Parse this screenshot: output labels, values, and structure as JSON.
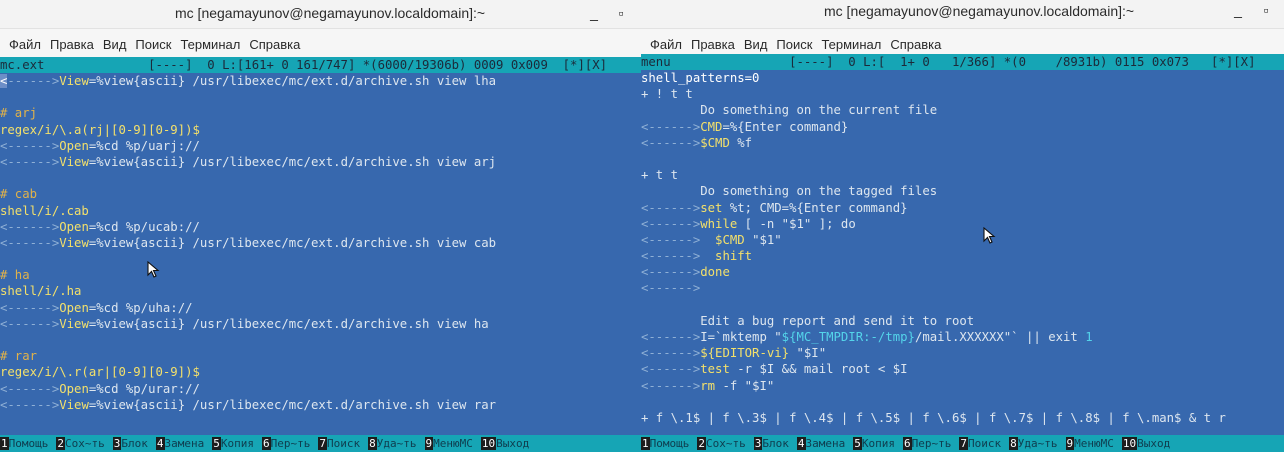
{
  "left": {
    "title": "mc [negamayunov@negamayunov.localdomain]:~",
    "btn_min": "_",
    "btn_max": "▫",
    "menu": [
      "Файл",
      "Правка",
      "Вид",
      "Поиск",
      "Терминал",
      "Справка"
    ],
    "status": "mc.ext              [----]  0 L:[161+ 0 161/747] *(6000/19306b) 0009 0x009  [*][X]",
    "lines": [
      [
        [
          "<",
          "sel"
        ],
        [
          "------>",
          "dim"
        ],
        [
          "View",
          "key"
        ],
        [
          "=%view{ascii} /usr/libexec/mc/ext.d/archive.sh view lha",
          "txt"
        ]
      ],
      [
        [
          "",
          "txt"
        ]
      ],
      [
        [
          "# arj",
          "cmt"
        ]
      ],
      [
        [
          "regex/i/\\.a(rj|[0-9][0-9])$",
          "key"
        ]
      ],
      [
        [
          "<------>",
          "dim"
        ],
        [
          "Open",
          "key"
        ],
        [
          "=%cd %p/uarj://",
          "txt"
        ]
      ],
      [
        [
          "<------>",
          "dim"
        ],
        [
          "View",
          "key"
        ],
        [
          "=%view{ascii} /usr/libexec/mc/ext.d/archive.sh view arj",
          "txt"
        ]
      ],
      [
        [
          "",
          "txt"
        ]
      ],
      [
        [
          "# cab",
          "cmt"
        ]
      ],
      [
        [
          "shell/i/.cab",
          "key"
        ]
      ],
      [
        [
          "<------>",
          "dim"
        ],
        [
          "Open",
          "key"
        ],
        [
          "=%cd %p/ucab://",
          "txt"
        ]
      ],
      [
        [
          "<------>",
          "dim"
        ],
        [
          "View",
          "key"
        ],
        [
          "=%view{ascii} /usr/libexec/mc/ext.d/archive.sh view cab",
          "txt"
        ]
      ],
      [
        [
          "",
          "txt"
        ]
      ],
      [
        [
          "# ha",
          "cmt"
        ]
      ],
      [
        [
          "shell/i/.ha",
          "key"
        ]
      ],
      [
        [
          "<------>",
          "dim"
        ],
        [
          "Open",
          "key"
        ],
        [
          "=%cd %p/uha://",
          "txt"
        ]
      ],
      [
        [
          "<------>",
          "dim"
        ],
        [
          "View",
          "key"
        ],
        [
          "=%view{ascii} /usr/libexec/mc/ext.d/archive.sh view ha",
          "txt"
        ]
      ],
      [
        [
          "",
          "txt"
        ]
      ],
      [
        [
          "# rar",
          "cmt"
        ]
      ],
      [
        [
          "regex/i/\\.r(ar|[0-9][0-9])$",
          "key"
        ]
      ],
      [
        [
          "<------>",
          "dim"
        ],
        [
          "Open",
          "key"
        ],
        [
          "=%cd %p/urar://",
          "txt"
        ]
      ],
      [
        [
          "<------>",
          "dim"
        ],
        [
          "View",
          "key"
        ],
        [
          "=%view{ascii} /usr/libexec/mc/ext.d/archive.sh view rar",
          "txt"
        ]
      ]
    ],
    "fkeys": [
      {
        "n": "1",
        "l": "Помощь"
      },
      {
        "n": "2",
        "l": "Сох~ть"
      },
      {
        "n": "3",
        "l": "Блок"
      },
      {
        "n": "4",
        "l": "Замена"
      },
      {
        "n": "5",
        "l": "Копия"
      },
      {
        "n": "6",
        "l": "Пер~ть"
      },
      {
        "n": "7",
        "l": "Поиск"
      },
      {
        "n": "8",
        "l": "Уда~ть"
      },
      {
        "n": "9",
        "l": "МенюМС"
      },
      {
        "n": "10",
        "l": "Выход"
      }
    ]
  },
  "right": {
    "title": "mc [negamayunov@negamayunov.localdomain]:~",
    "btn_min": "_",
    "btn_max": "▫",
    "menu": [
      "Файл",
      "Правка",
      "Вид",
      "Поиск",
      "Терминал",
      "Справка"
    ],
    "status": "menu                [----]  0 L:[  1+ 0   1/366] *(0    /8931b) 0115 0x073   [*][X]",
    "lines": [
      [
        [
          "shell_patterns=0",
          "white"
        ]
      ],
      [
        [
          "+ ! t t",
          "txt"
        ]
      ],
      [
        [
          "        Do something on the current file",
          "txt"
        ]
      ],
      [
        [
          "<------>",
          "dim"
        ],
        [
          "CMD",
          "key"
        ],
        [
          "=%{Enter command}",
          "txt"
        ]
      ],
      [
        [
          "<------>",
          "dim"
        ],
        [
          "$CMD",
          "key"
        ],
        [
          " %f",
          "txt"
        ]
      ],
      [
        [
          "",
          "txt"
        ]
      ],
      [
        [
          "+ t t",
          "txt"
        ]
      ],
      [
        [
          "        Do something on the tagged files",
          "txt"
        ]
      ],
      [
        [
          "<------>",
          "dim"
        ],
        [
          "set",
          "key"
        ],
        [
          " %t; CMD=%{Enter command}",
          "txt"
        ]
      ],
      [
        [
          "<------>",
          "dim"
        ],
        [
          "while",
          "key"
        ],
        [
          " [ -n \"$1\" ]; do",
          "txt"
        ]
      ],
      [
        [
          "<------>  ",
          "dim"
        ],
        [
          "$CMD",
          "key"
        ],
        [
          " \"$1\"",
          "txt"
        ]
      ],
      [
        [
          "<------>  ",
          "dim"
        ],
        [
          "shift",
          "key"
        ]
      ],
      [
        [
          "<------>",
          "dim"
        ],
        [
          "done",
          "key"
        ]
      ],
      [
        [
          "<------>",
          "dim"
        ]
      ],
      [
        [
          "",
          "txt"
        ]
      ],
      [
        [
          "        Edit a bug report and send it to root",
          "txt"
        ]
      ],
      [
        [
          "<------>",
          "dim"
        ],
        [
          "I=`mktemp \"",
          "txt"
        ],
        [
          "${MC_TMPDIR:-/tmp}",
          "cyan"
        ],
        [
          "/mail.XXXXXX\"` || exit ",
          "txt"
        ],
        [
          "1",
          "cyan"
        ]
      ],
      [
        [
          "<------>",
          "dim"
        ],
        [
          "${EDITOR-vi}",
          "key"
        ],
        [
          " \"$I\"",
          "txt"
        ]
      ],
      [
        [
          "<------>",
          "dim"
        ],
        [
          "test",
          "key"
        ],
        [
          " -r $I && mail root < $I",
          "txt"
        ]
      ],
      [
        [
          "<------>",
          "dim"
        ],
        [
          "rm",
          "key"
        ],
        [
          " -f \"$I\"",
          "txt"
        ]
      ],
      [
        [
          "",
          "txt"
        ]
      ],
      [
        [
          "+ f \\.1$ | f \\.3$ | f \\.4$ | f \\.5$ | f \\.6$ | f \\.7$ | f \\.8$ | f \\.man$ & t r",
          "txt"
        ]
      ]
    ],
    "fkeys": [
      {
        "n": "1",
        "l": "Помощь"
      },
      {
        "n": "2",
        "l": "Сох~ть"
      },
      {
        "n": "3",
        "l": "Блок"
      },
      {
        "n": "4",
        "l": "Замена"
      },
      {
        "n": "5",
        "l": "Копия"
      },
      {
        "n": "6",
        "l": "Пер~ть"
      },
      {
        "n": "7",
        "l": "Поиск"
      },
      {
        "n": "8",
        "l": "Уда~ть"
      },
      {
        "n": "9",
        "l": "МенюМС"
      },
      {
        "n": "10",
        "l": "Выход"
      }
    ]
  }
}
